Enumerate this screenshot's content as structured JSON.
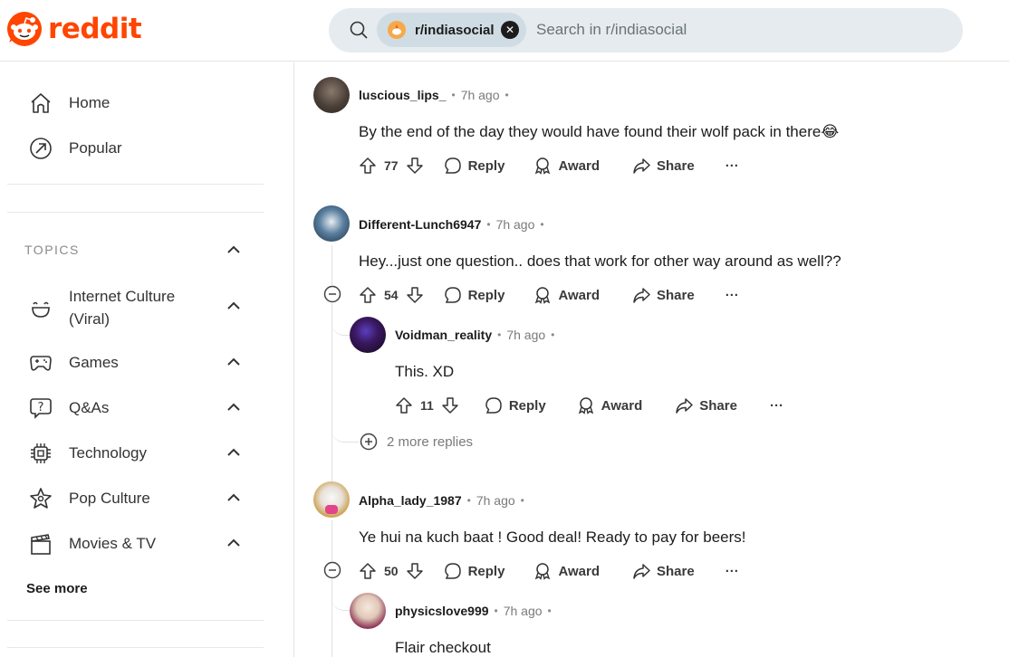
{
  "header": {
    "logo_text": "reddit",
    "brand_color": "#ff4500",
    "search": {
      "chip_label": "r/indiasocial",
      "placeholder": "Search in r/indiasocial"
    }
  },
  "sidebar": {
    "nav": [
      {
        "label": "Home",
        "icon": "home-icon"
      },
      {
        "label": "Popular",
        "icon": "popular-icon"
      }
    ],
    "topics_label": "TOPICS",
    "topics": [
      {
        "label_line1": "Internet Culture",
        "label_line2": "(Viral)",
        "icon": "smile-icon"
      },
      {
        "label": "Games",
        "icon": "gamepad-icon"
      },
      {
        "label": "Q&As",
        "icon": "question-icon"
      },
      {
        "label": "Technology",
        "icon": "chip-icon"
      },
      {
        "label": "Pop Culture",
        "icon": "star-icon"
      },
      {
        "label": "Movies & TV",
        "icon": "clapperboard-icon"
      }
    ],
    "see_more": "See more"
  },
  "comments": [
    {
      "username": "luscious_lips_",
      "time": "7h ago",
      "text": "By the end of the day they would have found their wolf pack in there😂",
      "votes": "77",
      "reply": "Reply",
      "award": "Award",
      "share": "Share"
    },
    {
      "username": "Different-Lunch6947",
      "time": "7h ago",
      "text": "Hey...just one question.. does that work for other way around as well??",
      "votes": "54",
      "reply": "Reply",
      "award": "Award",
      "share": "Share",
      "replies": [
        {
          "username": "Voidman_reality",
          "time": "7h ago",
          "text": "This. XD",
          "votes": "11",
          "reply": "Reply",
          "award": "Award",
          "share": "Share"
        }
      ],
      "more_replies": "2 more replies"
    },
    {
      "username": "Alpha_lady_1987",
      "time": "7h ago",
      "text": "Ye hui na kuch baat ! Good deal! Ready to pay for beers!",
      "votes": "50",
      "reply": "Reply",
      "award": "Award",
      "share": "Share",
      "replies": [
        {
          "username": "physicslove999",
          "time": "7h ago",
          "text": "Flair checkout"
        }
      ]
    }
  ],
  "separator": "•",
  "more_menu": "···"
}
